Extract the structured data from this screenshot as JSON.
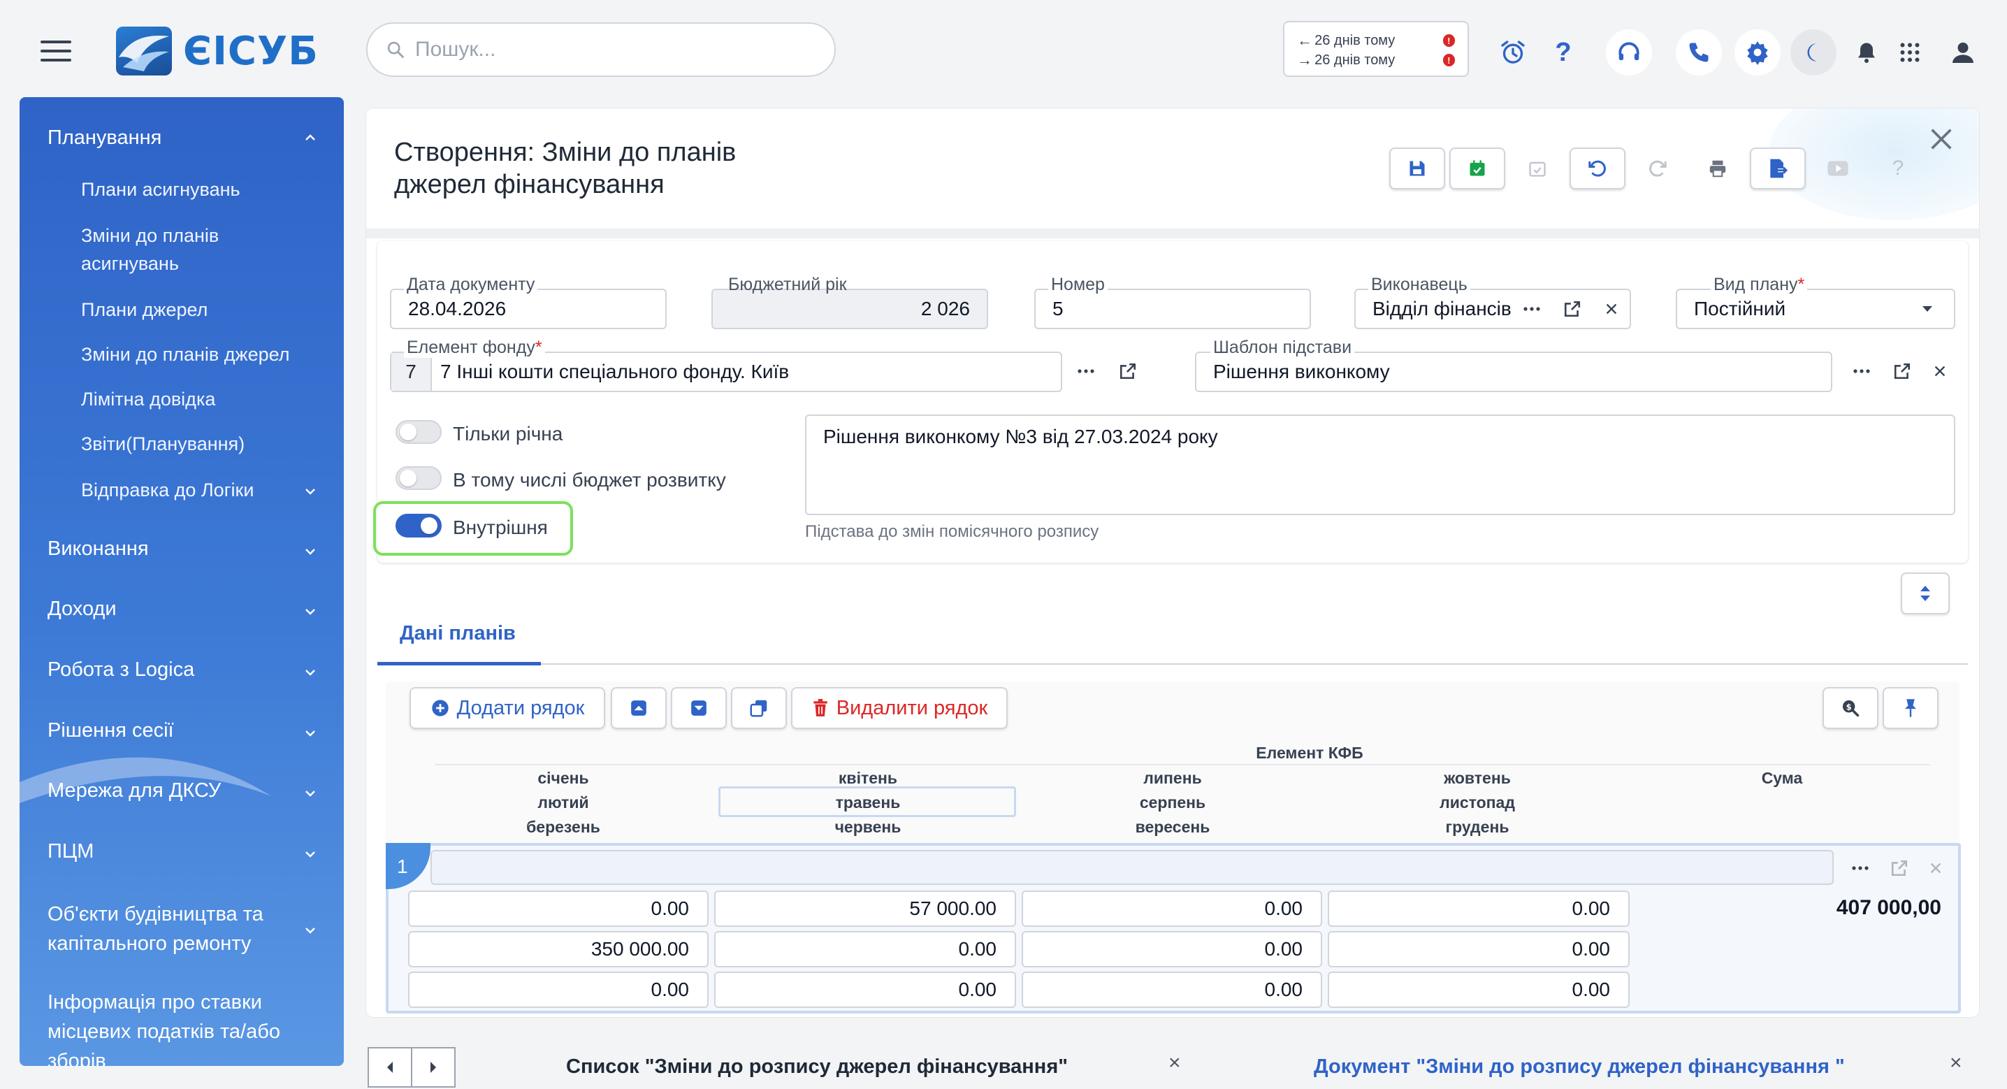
{
  "app": {
    "logo_text": "ЄІСУБ"
  },
  "search": {
    "placeholder": "Пошук..."
  },
  "history": {
    "back": "26 днів тому",
    "forward": "26 днів тому"
  },
  "sidebar": {
    "sections": [
      {
        "label": "Планування",
        "expanded": true
      },
      {
        "label": "Виконання"
      },
      {
        "label": "Доходи"
      },
      {
        "label": "Робота з Logica"
      },
      {
        "label": "Рішення сесії"
      },
      {
        "label": "Мережа для ДКСУ"
      },
      {
        "label": "ПЦМ"
      },
      {
        "label": "Об'єкти будівництва та капітального ремонту"
      },
      {
        "label": "Інформація про ставки місцевих податків та/або зборів"
      }
    ],
    "sub_items": [
      "Плани асигнувань",
      "Зміни до планів асигнувань",
      "Плани джерел",
      "Зміни до планів джерел",
      "Лімітна довідка",
      "Звіти(Планування)",
      "Відправка до Логіки"
    ]
  },
  "page": {
    "title": "Створення: Зміни до планів джерел фінансування"
  },
  "form": {
    "doc_date": {
      "label": "Дата документу",
      "value": "28.04.2026"
    },
    "budget_year": {
      "label": "Бюджетний рік",
      "value": "2 026"
    },
    "number": {
      "label": "Номер",
      "value": "5"
    },
    "executor": {
      "label": "Виконавець",
      "value": "Відділ фінансів"
    },
    "plan_type": {
      "label": "Вид плану",
      "value": "Постійний"
    },
    "fund_element": {
      "label": "Елемент фонду",
      "code": "7",
      "value": "7 Інші кошти спеціального фонду. Київ"
    },
    "basis_template": {
      "label": "Шаблон підстави",
      "value": "Рішення виконкому"
    },
    "toggles": [
      {
        "label": "Тільки річна",
        "on": false
      },
      {
        "label": "В тому числі бюджет розвитку",
        "on": false
      },
      {
        "label": "Внутрішня",
        "on": true
      }
    ],
    "basis_text": "Рішення виконкому №3 від 27.03.2024 року",
    "basis_hint": "Підстава до змін помісячного розпису"
  },
  "tabs": {
    "plan_data": "Дані планів"
  },
  "grid": {
    "add_row": "Додати рядок",
    "delete_row": "Видалити рядок",
    "header_group": "Елемент КФБ",
    "months": [
      [
        "січень",
        "квітень",
        "липень",
        "жовтень"
      ],
      [
        "лютий",
        "травень",
        "серпень",
        "листопад"
      ],
      [
        "березень",
        "червень",
        "вересень",
        "грудень"
      ]
    ],
    "sum_label": "Сума",
    "row_number": "1",
    "values": [
      [
        "0.00",
        "57 000.00",
        "0.00",
        "0.00"
      ],
      [
        "350 000.00",
        "0.00",
        "0.00",
        "0.00"
      ],
      [
        "0.00",
        "0.00",
        "0.00",
        "0.00"
      ]
    ],
    "total": "407 000,00"
  },
  "bottom_tabs": {
    "list": "Список \"Зміни до розпису джерел фінансування\"",
    "document": "Документ \"Зміни до розпису джерел фінансування \""
  },
  "colors": {
    "accent": "#2f63c7",
    "highlight": "#7ee05a",
    "danger": "#dc2626",
    "success": "#16a34a"
  }
}
